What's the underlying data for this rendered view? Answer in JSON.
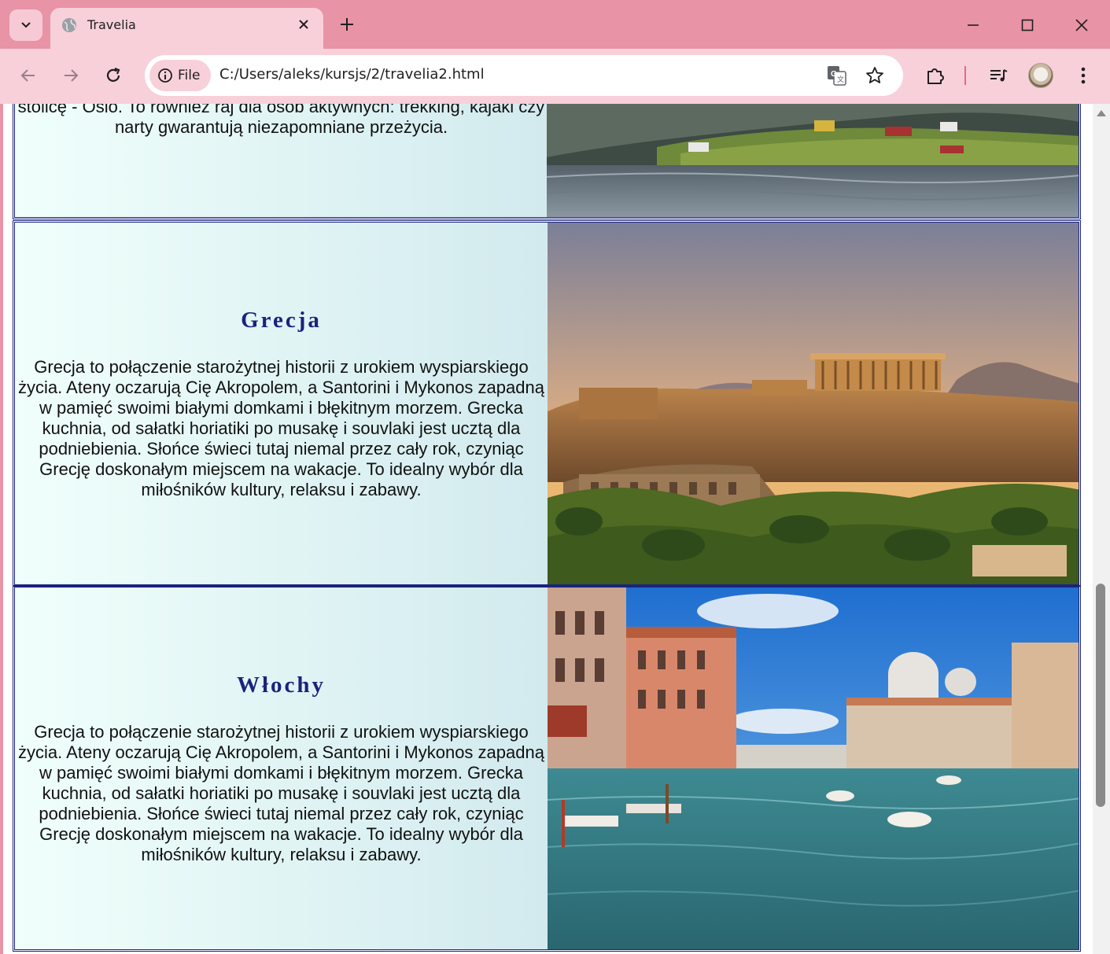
{
  "browser": {
    "tab_title": "Travelia",
    "chip_label": "File",
    "url": "C:/Users/aleks/kursjs/2/travelia2.html"
  },
  "icons": {
    "tab_menu": "chevron-down-icon",
    "tab_favicon": "globe-icon",
    "tab_close": "close-icon",
    "new_tab": "plus-icon",
    "minimize": "minimize-icon",
    "maximize": "maximize-icon",
    "close_window": "close-icon",
    "back": "arrow-left-icon",
    "forward": "arrow-right-icon",
    "reload": "reload-icon",
    "site_info": "info-icon",
    "translate": "translate-icon",
    "bookmark": "star-icon",
    "extensions": "puzzle-icon",
    "media": "media-controls-icon",
    "profile": "avatar",
    "menu": "more-vertical-icon"
  },
  "colors": {
    "frame": "#e993a6",
    "toolbar": "#f7d0da",
    "heading": "#1a237e",
    "cell_gradient_start": "#f0fffb",
    "cell_gradient_end": "#d2eaee"
  },
  "page": {
    "norway": {
      "text_partial": "po Norwegii to okazja, by zobaczyć słynny Geirangerfjord, Lofoty czy stolicę - Oslo. To również raj dla osób aktywnych: trekking, kajaki czy narty gwarantują niezapomniane przeżycia."
    },
    "greece": {
      "title": "Grecja",
      "text": "Grecja to połączenie starożytnej historii z urokiem wyspiarskiego życia. Ateny oczarują Cię Akropolem, a Santorini i Mykonos zapadną w pamięć swoimi białymi domkami i błękitnym morzem. Grecka kuchnia, od sałatki horiatiki po musakę i souvlaki jest ucztą dla podniebienia. Słońce świeci tutaj niemal przez cały rok, czyniąc Grecję doskonałym miejscem na wakacje. To idealny wybór dla miłośników kultury, relaksu i zabawy."
    },
    "italy": {
      "title": "Włochy",
      "text": "Grecja to połączenie starożytnej historii z urokiem wyspiarskiego życia. Ateny oczarują Cię Akropolem, a Santorini i Mykonos zapadną w pamięć swoimi białymi domkami i błękitnym morzem. Grecka kuchnia, od sałatki horiatiki po musakę i souvlaki jest ucztą dla podniebienia. Słońce świeci tutaj niemal przez cały rok, czyniąc Grecję doskonałym miejscem na wakacje. To idealny wybór dla miłośników kultury, relaksu i zabawy."
    }
  }
}
